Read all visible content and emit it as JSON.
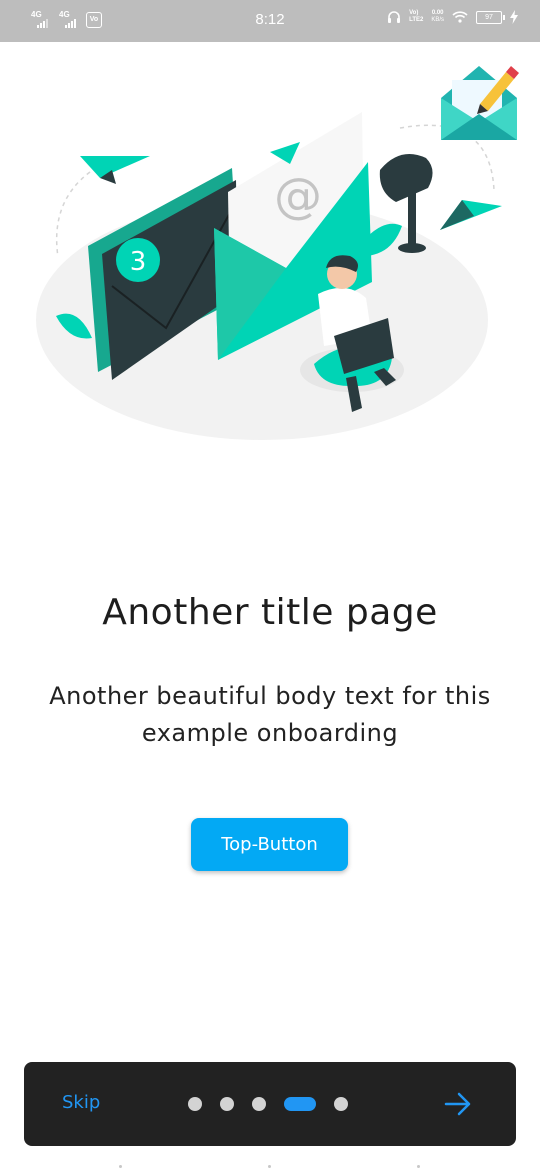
{
  "status_bar": {
    "sim1_net": "4G",
    "sim2_net": "4G",
    "vo_label": "Vo",
    "time": "8:12",
    "volte_top": "Vo)",
    "volte_bottom": "LTE2",
    "speed_value": "0.00",
    "speed_unit": "KB/s",
    "battery": "97"
  },
  "onboarding": {
    "title": "Another title page",
    "body": "Another beautiful body text for this example onboarding",
    "top_button_label": "Top-Button",
    "envelope_badge": "3",
    "envelope_symbol": "@"
  },
  "bottom_bar": {
    "skip_label": "Skip",
    "dots": [
      false,
      false,
      false,
      true,
      false
    ]
  },
  "colors": {
    "accent": "#2196f3",
    "button": "#03a9f4",
    "teal": "#00d4b5",
    "dark_teal": "#2a3b3f"
  }
}
